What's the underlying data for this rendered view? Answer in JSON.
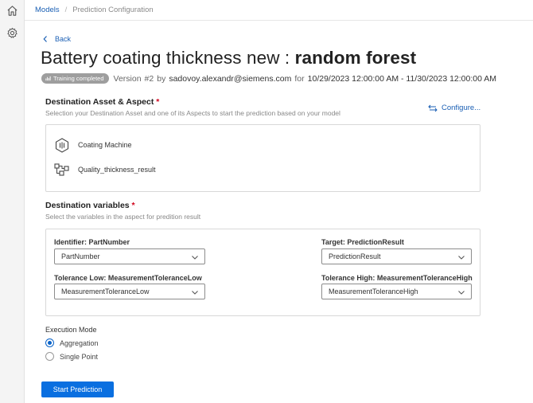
{
  "breadcrumb": {
    "models": "Models",
    "separator": "/",
    "current": "Prediction Configuration"
  },
  "nav": {
    "back": "Back"
  },
  "header": {
    "title_prefix": "Battery coating thickness new : ",
    "title_model": "random forest",
    "badge": "Training completed",
    "version_label": "Version",
    "version": "#2",
    "by": "by",
    "user": "sadovoy.alexandr@siemens.com",
    "for": "for",
    "range": "10/29/2023 12:00:00 AM - 11/30/2023 12:00:00 AM"
  },
  "destination_asset": {
    "title": "Destination Asset & Aspect",
    "required_mark": "*",
    "subtitle": "Selection your Destination Asset and one of its Aspects to start the prediction based on your model",
    "configure": "Configure...",
    "asset_name": "Coating Machine",
    "aspect_name": "Quality_thickness_result"
  },
  "destination_variables": {
    "title": "Destination variables",
    "required_mark": "*",
    "subtitle": "Select the variables in the aspect for predition result",
    "fields": {
      "identifier": {
        "label": "Identifier: PartNumber",
        "value": "PartNumber"
      },
      "target": {
        "label": "Target: PredictionResult",
        "value": "PredictionResult"
      },
      "tol_low": {
        "label": "Tolerance Low: MeasurementToleranceLow",
        "value": "MeasurementToleranceLow"
      },
      "tol_high": {
        "label": "Tolerance High: MeasurementToleranceHigh",
        "value": "MeasurementToleranceHigh"
      }
    }
  },
  "execution": {
    "label": "Execution Mode",
    "options": [
      "Aggregation",
      "Single Point"
    ],
    "selected": "Aggregation"
  },
  "actions": {
    "start": "Start Prediction"
  },
  "colors": {
    "accent": "#0a6fe0",
    "link": "#1a5fb4",
    "required": "#d0021b",
    "badge": "#9e9e9e"
  },
  "icons": [
    "home-icon",
    "settings-cog-icon",
    "chevron-left-icon",
    "configure-arrows-icon",
    "asset-hexagon-icon",
    "aspect-nodes-icon",
    "chevron-down-icon"
  ]
}
